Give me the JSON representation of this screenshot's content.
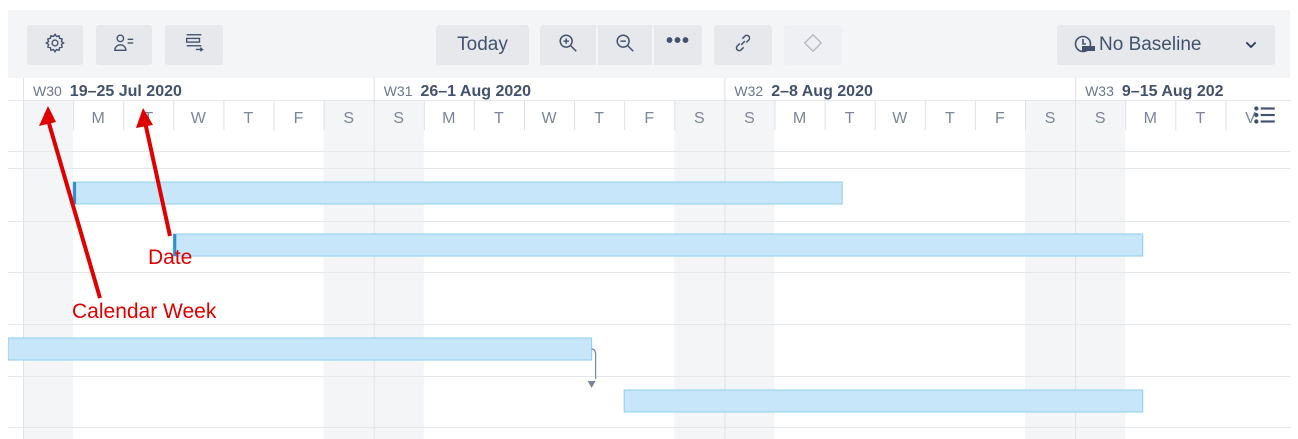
{
  "toolbar": {
    "settings_icon": "gear-icon",
    "people_icon": "user-list-icon",
    "structure_icon": "hierarchy-icon",
    "today_label": "Today",
    "zoom_in_icon": "zoom-in-icon",
    "zoom_out_icon": "zoom-out-icon",
    "more_label": "•••",
    "link_icon": "link-icon",
    "milestone_icon": "diamond-icon",
    "baseline_label": "No Baseline",
    "baseline_icon": "baseline-clock-icon",
    "baseline_dropdown_icon": "chevron-down-icon"
  },
  "timeline": {
    "weeks": [
      {
        "code": "W30",
        "range": "19–25 Jul 2020"
      },
      {
        "code": "W31",
        "range": "26–1 Aug 2020"
      },
      {
        "code": "W32",
        "range": "2–8 Aug 2020"
      },
      {
        "code": "W33",
        "range": "9–15 Aug 202"
      }
    ],
    "day_letters": [
      "S",
      "M",
      "T",
      "W",
      "T",
      "F",
      "S",
      "S",
      "M",
      "T",
      "W",
      "T",
      "F",
      "S",
      "S",
      "M",
      "T",
      "W",
      "T",
      "F",
      "S",
      "S",
      "M",
      "T",
      "V"
    ],
    "menu_icon": "list-menu-icon",
    "bars": [
      {
        "start": "2020-07-20",
        "end": "2020-08-04"
      },
      {
        "start": "2020-07-22",
        "end": "2020-08-10"
      },
      {
        "start": "2020-07-18",
        "end": "2020-07-30"
      },
      {
        "start": "2020-07-31",
        "end": "2020-08-10"
      }
    ],
    "dependency": {
      "from": "bar-3",
      "to": "bar-4"
    }
  },
  "annotations": {
    "date_label": "Date",
    "week_label": "Calendar Week",
    "color": "#e00000"
  },
  "colors": {
    "bar_fill": "#c7e6fa",
    "bar_border": "#8ecdf0",
    "bar_marker": "#2f8fd0",
    "weekend_shade": "#f4f5f7"
  }
}
